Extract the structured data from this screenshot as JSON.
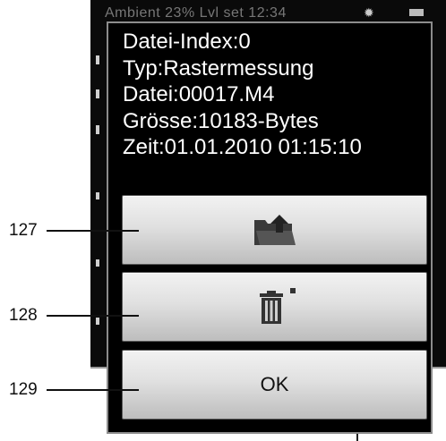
{
  "statusbar": {
    "text": "Ambient 23% Lvl set 12:34"
  },
  "dialog": {
    "info_lines": [
      "Datei-Index:0",
      "Typ:Rastermessung",
      "Datei:00017.M4",
      "Grösse:10183-Bytes",
      "Zeit:01.01.2010 01:15:10"
    ],
    "buttons": {
      "export_icon": "folder-export-icon",
      "delete_icon": "trash-icon",
      "ok_label": "OK"
    }
  },
  "callouts": [
    "127",
    "128",
    "129"
  ],
  "colors": {
    "dialog_bg": "#000000",
    "dialog_text": "#ffffff",
    "button_face": "#e0e0e0",
    "icon": "#333333"
  }
}
